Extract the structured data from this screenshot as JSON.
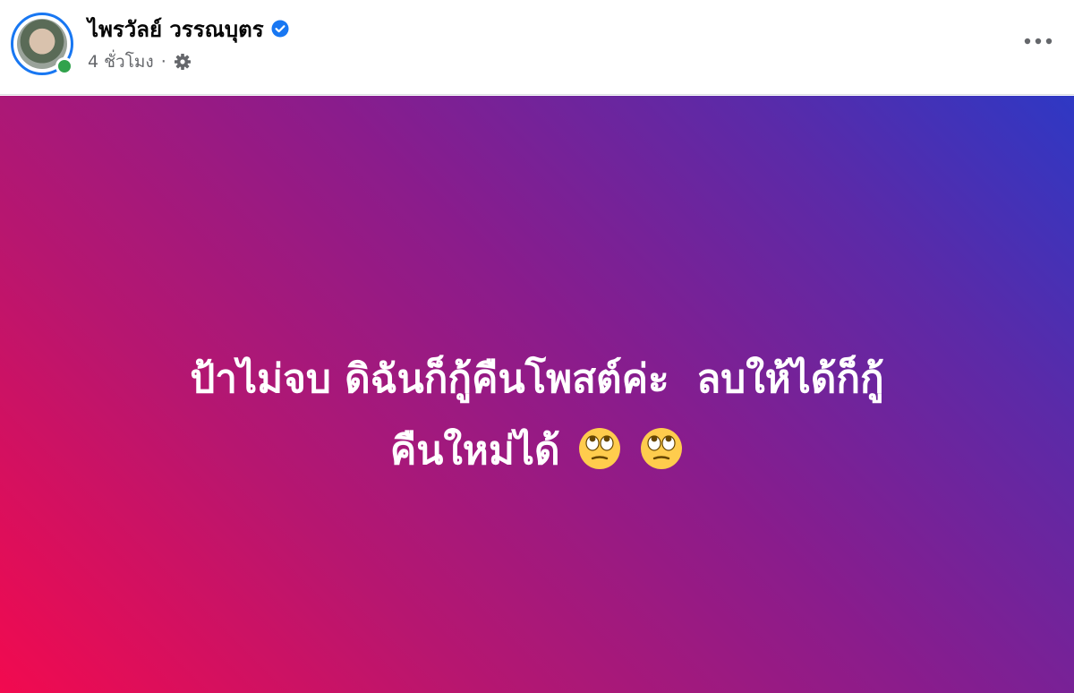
{
  "post": {
    "author_name": "ไพรวัลย์ วรรณบุตร",
    "timestamp": "4 ชั่วโมง",
    "separator": "·",
    "privacy_icon": "gear-icon",
    "verified_icon": "verified-badge-icon",
    "more_icon": "more-options-icon",
    "body_line1": "ป้าไม่จบ ดิฉันก็กู้คืนโพสต์ค่ะ ￼ ลบให้ได้ก็กู้",
    "body_line2": "คืนใหม่ได้",
    "emoji": [
      "face-with-rolling-eyes",
      "face-with-rolling-eyes"
    ]
  },
  "colors": {
    "verified": "#1877f2",
    "online": "#31a24c",
    "gradient_start": "#f20a4f",
    "gradient_end": "#2e38c4",
    "meta_text": "#65676b"
  }
}
